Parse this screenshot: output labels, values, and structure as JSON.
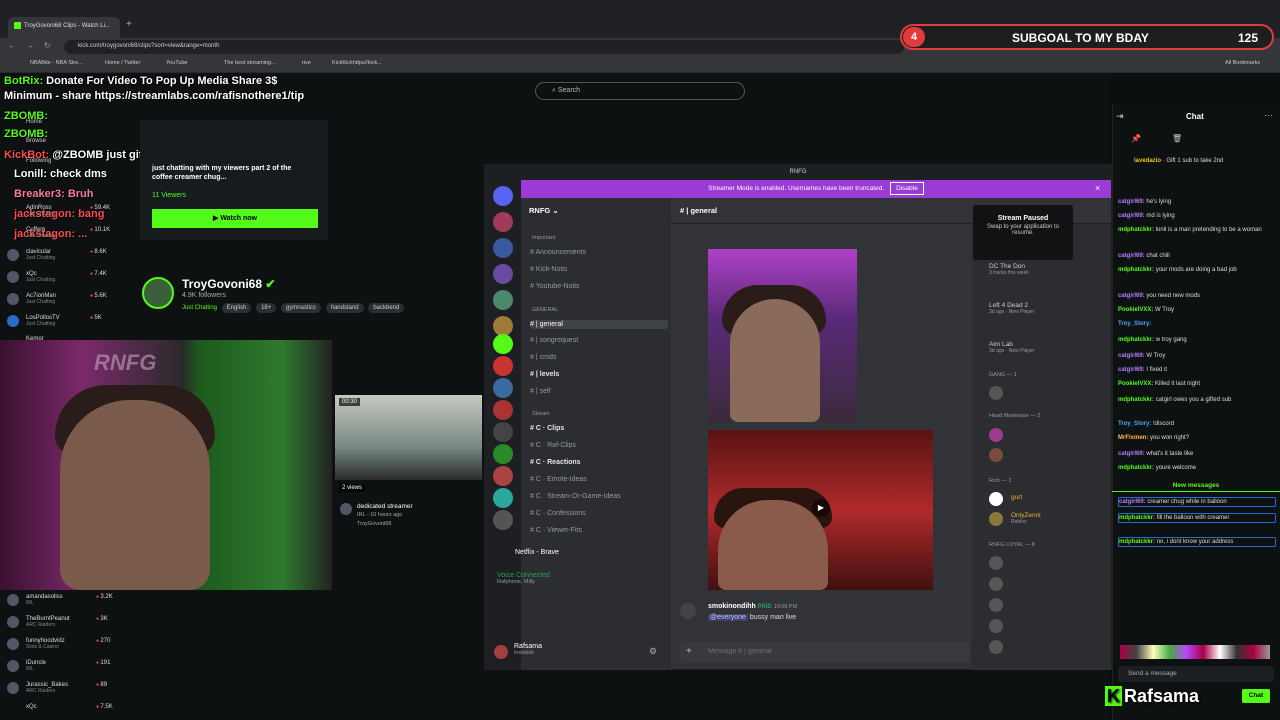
{
  "browser": {
    "tab_title": "TroyGovoni68 Clips - Watch Li...",
    "url": "kick.com/troygovoni68/clips?sort=view&range=month",
    "bookmarks": [
      "NBABite - NBA Stre...",
      "Home / Twitter",
      "YouTube",
      "The best streaming...",
      "rive",
      "KickKickhttps//kick..."
    ],
    "all_bookmarks": "All Bookmarks"
  },
  "subgoal": {
    "count": "4",
    "title": "SUBGOAL TO MY BDAY",
    "value": "125"
  },
  "kick": {
    "search_placeholder": "Search",
    "alerts": {
      "line1_user": "BotRix:",
      "line1_text": "Donate For Video To Pop Up Media Share 3$",
      "line2": "Minimum - share https://streamlabs.com/rafisnothere1/tip",
      "zbomb1": "ZBOMB:",
      "zbomb2": "ZBOMB:",
      "kickbot_user": "KickBot:",
      "kickbot_text": "@ZBOMB just gifted 1 KICKs!",
      "lonill": "Lonill: check dms",
      "breaker": "Breaker3: Bruh",
      "jackstagon1": "jackstagon: bang",
      "jackstagon2": "jackstagon: ..."
    },
    "nav": {
      "home": "Home",
      "browse": "Browse",
      "following": "Following"
    },
    "side_channels": [
      {
        "name": "AdinRoss",
        "cat": "Just Chatting",
        "viewers": "59.4K"
      },
      {
        "name": "Cuffem",
        "cat": "Just Chatting",
        "viewers": "10.1K"
      },
      {
        "name": "clavicular",
        "cat": "Just Chatting",
        "viewers": "8.6K"
      },
      {
        "name": "xQc",
        "cat": "Just Chatting",
        "viewers": "7.4K"
      },
      {
        "name": "Ac7ionMan",
        "cat": "Just Chatting",
        "viewers": "5.6K"
      },
      {
        "name": "LosPollosTV",
        "cat": "Just Chatting",
        "viewers": "5K"
      },
      {
        "name": "Kemor",
        "cat": "",
        "viewers": ""
      }
    ],
    "side_channels_bottom": [
      {
        "name": "amandasoliss",
        "cat": "IRL",
        "viewers": "3.2K"
      },
      {
        "name": "TheBurntPeanut",
        "cat": "ARC Raiders",
        "viewers": "3K"
      },
      {
        "name": "funnyhoodvidz",
        "cat": "Slots & Casino",
        "viewers": "270"
      },
      {
        "name": "iDuncle",
        "cat": "IRL",
        "viewers": "191"
      },
      {
        "name": "Jurassic_Bakes",
        "cat": "ARC Raiders",
        "viewers": "89"
      },
      {
        "name": "xQc",
        "cat": "",
        "viewers": "7.5K"
      }
    ],
    "live_card": {
      "title": "just chatting with my viewers part 2 of the coffee creamer chug...",
      "viewers": "11 Viewers",
      "watch": "▶ Watch now"
    },
    "profile": {
      "name": "TroyGovoni68",
      "followers": "4.9K followers",
      "category": "Just Chatting",
      "tags": [
        "English",
        "18+",
        "gymnastics",
        "handstand",
        "backbend"
      ]
    },
    "clip": {
      "time": "00:30",
      "views": "2 views",
      "title": "dedicated streamer",
      "meta": "IRL - 10 hours ago",
      "channel": "TroyGovoni68"
    }
  },
  "discord": {
    "window_title": "RNFG",
    "streamer_mode": "Streamer Mode is enabled. Usernames have been truncated.",
    "disable": "Disable",
    "server": "RNFG",
    "channel": "general",
    "categories": {
      "important": "Important",
      "general": "GENERAL",
      "stream": "Stream"
    },
    "channels": [
      {
        "n": "Announcements"
      },
      {
        "n": "Kick-Notis"
      },
      {
        "n": "Youtube-Notis"
      },
      {
        "n": "general"
      },
      {
        "n": "songrequest"
      },
      {
        "n": "cmds"
      },
      {
        "n": "levels"
      },
      {
        "n": "self"
      },
      {
        "n": "Clips"
      },
      {
        "n": "Raf-Clips"
      },
      {
        "n": "Reactions"
      },
      {
        "n": "Emote-Ideas"
      },
      {
        "n": "Stream-Or-Game-Ideas"
      },
      {
        "n": "Confessions"
      },
      {
        "n": "Viewer-Fits"
      }
    ],
    "netflix": "Netflix - Brave",
    "voice": "Voice Connected",
    "voice_sub": "Rafphone, Milly",
    "user": "Rafsama",
    "user_status": "Invisible",
    "paused_title": "Stream Paused",
    "paused_text": "Swap to your application to resume.",
    "members": [
      {
        "n": "DC The Don",
        "s": "3 tracks this week",
        "t": "303"
      },
      {
        "n": "Left 4 Dead 2",
        "s": "3d ago · New Player",
        "t": "335"
      },
      {
        "n": "Aim Lab",
        "s": "3d ago · New Player",
        "t": "372"
      },
      {
        "g": "GANG — 1",
        "t": "401"
      },
      {
        "g": "Head Moderator — 2",
        "t": "440"
      },
      {
        "g": "Rich — 2",
        "t": "504"
      },
      {
        "n": "gurt",
        "t": "520"
      },
      {
        "n": "OnlyZenni",
        "s": "Roblox",
        "t": "537"
      },
      {
        "g": "RNFG LOYAL — 8",
        "t": "567"
      }
    ],
    "msg_user": "smokinondihh",
    "msg_badge": "PAID",
    "msg_time": "10:08 PM",
    "msg_mention": "@everyone",
    "msg_text": "bussy man live",
    "input_placeholder": "Message # | general"
  },
  "chat": {
    "title": "Chat",
    "gift_user": "lavedazio",
    "gift_text": "Gift 1 sub to take 2nd",
    "messages": [
      {
        "u": "catgirl69:",
        "t": "he's lying",
        "c": "#b57cff"
      },
      {
        "u": "catgirl69:",
        "t": "md is lying",
        "c": "#b57cff"
      },
      {
        "u": "mdphatckkr:",
        "t": "lonil is a man pretending to be a woman",
        "c": "#53fc18"
      },
      {
        "u": "catgirl69:",
        "t": "chat chill",
        "c": "#b57cff"
      },
      {
        "u": "mdphatckkr:",
        "t": "your mods are doing a bad job",
        "c": "#53fc18"
      },
      {
        "u": "catgirl69:",
        "t": "you need new mods",
        "c": "#b57cff"
      },
      {
        "u": "PookielVXX:",
        "t": "W Troy",
        "c": "#53fc18"
      },
      {
        "u": "Troy_Story:",
        "t": "",
        "c": "#4da6ff"
      },
      {
        "u": "mdphatckkr:",
        "t": "w troy gang",
        "c": "#53fc18"
      },
      {
        "u": "catgirl69:",
        "t": "W Troy",
        "c": "#b57cff"
      },
      {
        "u": "catgirl69:",
        "t": "I fixed it",
        "c": "#b57cff"
      },
      {
        "u": "PookielVXX:",
        "t": "Killed it last night",
        "c": "#53fc18"
      },
      {
        "u": "mdphatckkr:",
        "t": "catgirl owes you a gifted sub",
        "c": "#53fc18"
      },
      {
        "u": "Troy_Story:",
        "t": "!discord",
        "c": "#4da6ff"
      },
      {
        "u": "MrFixmen:",
        "t": "you won right?",
        "c": "#ffb84d"
      },
      {
        "u": "catgirl69:",
        "t": "what's it taste like",
        "c": "#b57cff"
      },
      {
        "u": "mdphatckkr:",
        "t": "youre welcome",
        "c": "#53fc18"
      }
    ],
    "new_messages": "New messages",
    "new": [
      {
        "u": "catgirl69:",
        "t": "creamer chug while in balloon",
        "c": "#b57cff"
      },
      {
        "u": "mdphatckkr:",
        "t": "fill the balloon with creamer",
        "c": "#53fc18"
      },
      {
        "u": "mdphatckkr:",
        "t": "no, i dont know your address",
        "c": "#53fc18"
      }
    ],
    "send_placeholder": "Send a message",
    "send": "Chat",
    "watermark": "Rafsama"
  }
}
